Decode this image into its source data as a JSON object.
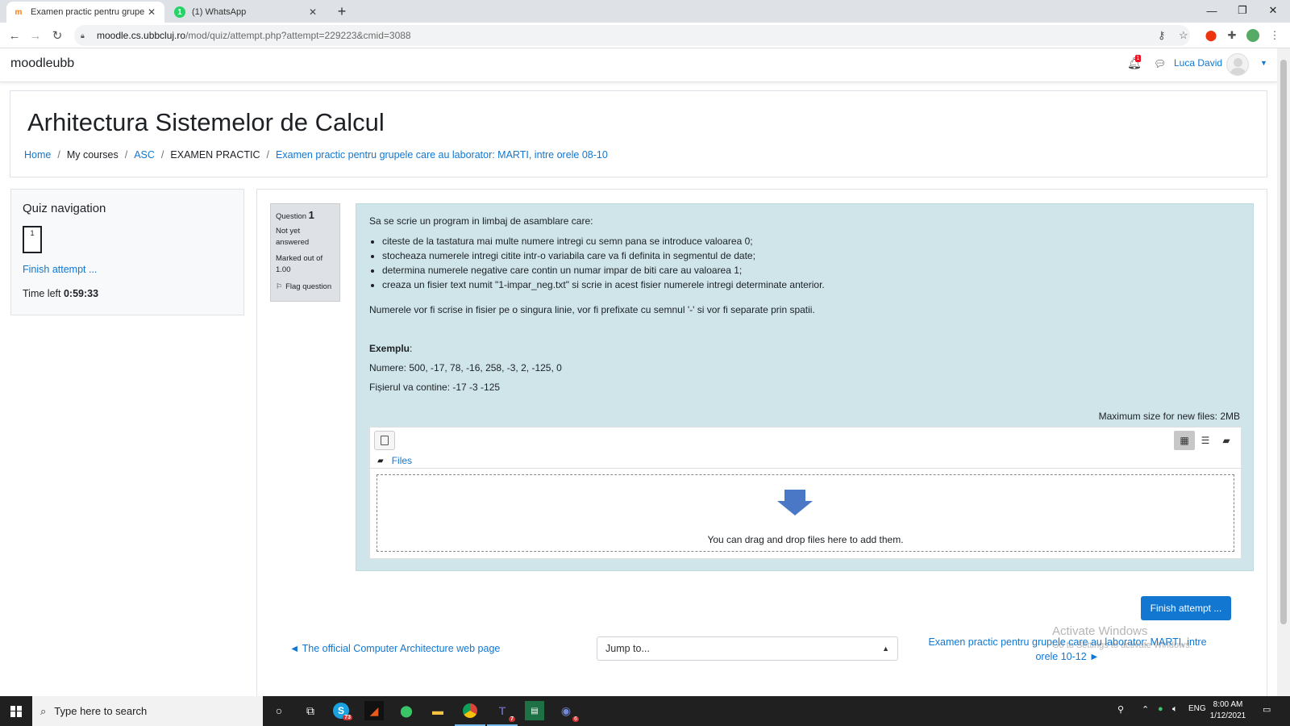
{
  "browser": {
    "tabs": [
      {
        "title": "Examen practic pentru grupele c",
        "active": true
      },
      {
        "title": "(1) WhatsApp",
        "active": false
      }
    ],
    "url_host": "moodle.cs.ubbcluj.ro",
    "url_path": "/mod/quiz/attempt.php?attempt=229223&cmid=3088"
  },
  "navbar": {
    "brand": "moodleubb",
    "notification_count": "1",
    "user_name": "Luca David"
  },
  "header": {
    "course_title": "Arhitectura Sistemelor de Calcul",
    "breadcrumb": [
      "Home",
      "My courses",
      "ASC",
      "EXAMEN PRACTIC",
      "Examen practic pentru grupele care au laborator: MARTI, intre orele 08-10"
    ]
  },
  "quiz_nav": {
    "title": "Quiz navigation",
    "question_number": "1",
    "finish_link": "Finish attempt ...",
    "time_left_label": "Time left",
    "time_left_value": "0:59:33"
  },
  "question": {
    "label": "Question",
    "number": "1",
    "state": "Not yet answered",
    "marked": "Marked out of 1.00",
    "flag": "Flag question",
    "intro": "Sa se scrie un program in limbaj de asamblare care:",
    "bullets": [
      "citeste de la tastatura mai multe numere intregi cu semn pana se introduce valoarea 0;",
      "stocheaza numerele intregi citite intr-o variabila care va fi definita in segmentul de date;",
      "determina numerele negative care contin un numar impar de biti care au valoarea 1;",
      "creaza un fisier text numit \"1-impar_neg.txt\" si scrie in acest fisier numerele intregi determinate anterior."
    ],
    "paragraph": "Numerele vor fi scrise in fisier pe o singura linie, vor fi prefixate cu semnul '-' si vor fi separate prin spatii.",
    "example_heading": "Exemplu",
    "example_numbers": "Numere: 500, -17, 78, -16, 258, -3, 2, -125, 0",
    "example_file": "Fișierul va contine: -17 -3 -125",
    "max_size": "Maximum size for new files: 2MB",
    "files_label": "Files",
    "drop_text": "You can drag and drop files here to add them."
  },
  "footer": {
    "finish_button": "Finish attempt ...",
    "prev_link": "◄ The official Computer Architecture web page",
    "jump_placeholder": "Jump to...",
    "next_link": "Examen practic pentru grupele care au laborator: MARTI, intre orele 10-12 ►"
  },
  "watermark": {
    "line1": "Activate Windows",
    "line2": "Go to Settings to activate Windows."
  },
  "taskbar": {
    "search_placeholder": "Type here to search",
    "skype_badge": "73",
    "teams_badge": "7",
    "discord_badge": "6",
    "lang": "ENG",
    "time": "8:00 AM",
    "date": "1/12/2021"
  },
  "colors": {
    "link": "#1177d1",
    "formulation_bg": "#cfe5ea",
    "taskbar": "#202020"
  }
}
